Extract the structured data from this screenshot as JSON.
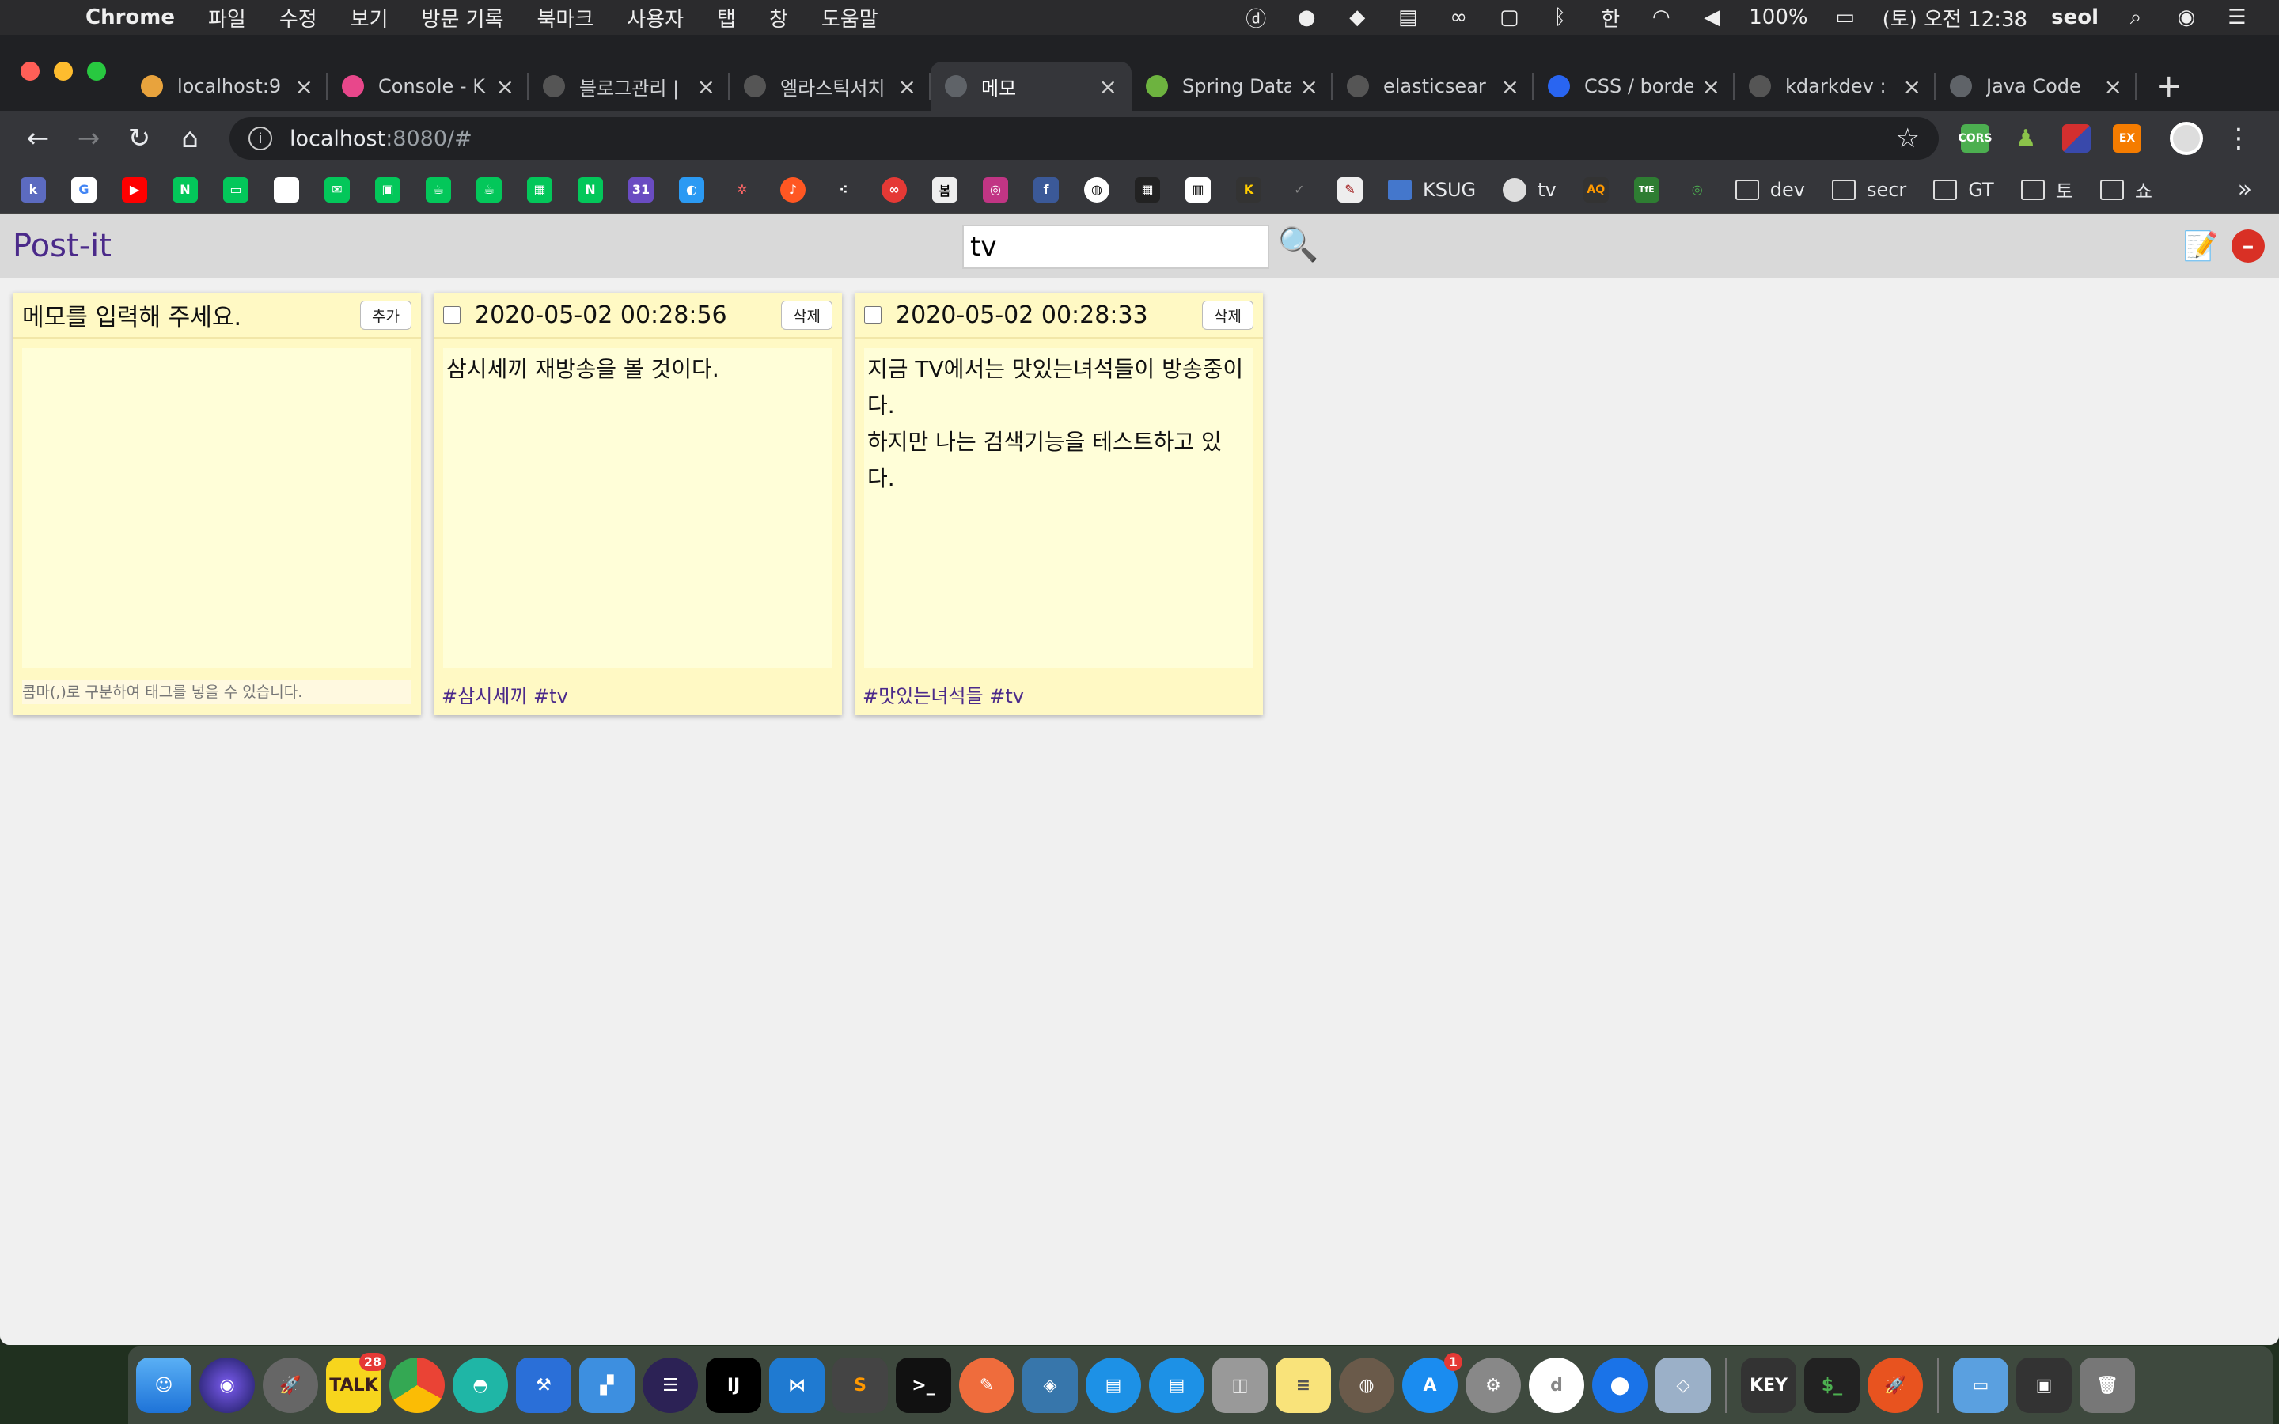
{
  "menubar": {
    "app": "Chrome",
    "items": [
      "파일",
      "수정",
      "보기",
      "방문 기록",
      "북마크",
      "사용자",
      "탭",
      "창",
      "도움말"
    ],
    "battery": "100%",
    "clock": "(토) 오전 12:38",
    "user": "seol",
    "ime": "한"
  },
  "tabs": [
    {
      "title": "localhost:9",
      "color": "#e8a33d"
    },
    {
      "title": "Console - K",
      "color": "#e8478b"
    },
    {
      "title": "블로그관리 |",
      "color": "#555555"
    },
    {
      "title": "엘라스틱서치",
      "color": "#555555"
    },
    {
      "title": "메모",
      "color": "#5f6368"
    },
    {
      "title": "Spring Data",
      "color": "#6db33f"
    },
    {
      "title": "elasticsear",
      "color": "#555555"
    },
    {
      "title": "CSS / borde",
      "color": "#2965f1"
    },
    {
      "title": "kdarkdev :",
      "color": "#555555"
    },
    {
      "title": "Java Code",
      "color": "#5f6368"
    }
  ],
  "url": {
    "host": "localhost",
    "path": ":8080/#"
  },
  "bookmarks": {
    "text_items": [
      "KSUG",
      "tv",
      "dev",
      "secr",
      "GT",
      "토",
      "쇼"
    ]
  },
  "app": {
    "title": "Post-it",
    "search_value": "tv"
  },
  "notes": {
    "new_note": {
      "header": "메모를 입력해 주세요.",
      "add_label": "추가",
      "tag_placeholder": "콤마(,)로 구분하여 태그를 넣을 수 있습니다."
    },
    "items": [
      {
        "timestamp": "2020-05-02 00:28:56",
        "delete_label": "삭제",
        "body": "삼시세끼 재방송을 볼 것이다.",
        "tags": "#삼시세끼 #tv"
      },
      {
        "timestamp": "2020-05-02 00:28:33",
        "delete_label": "삭제",
        "body": "지금 TV에서는 맛있는녀석들이 방송중이\n다.\n하지만 나는 검색기능을 테스트하고 있\n다.",
        "tags": "#맛있는녀석들 #tv"
      }
    ]
  },
  "dock": {
    "kakao_badge": "28",
    "appstore_badge": "1",
    "keynote_label": "KEY"
  }
}
